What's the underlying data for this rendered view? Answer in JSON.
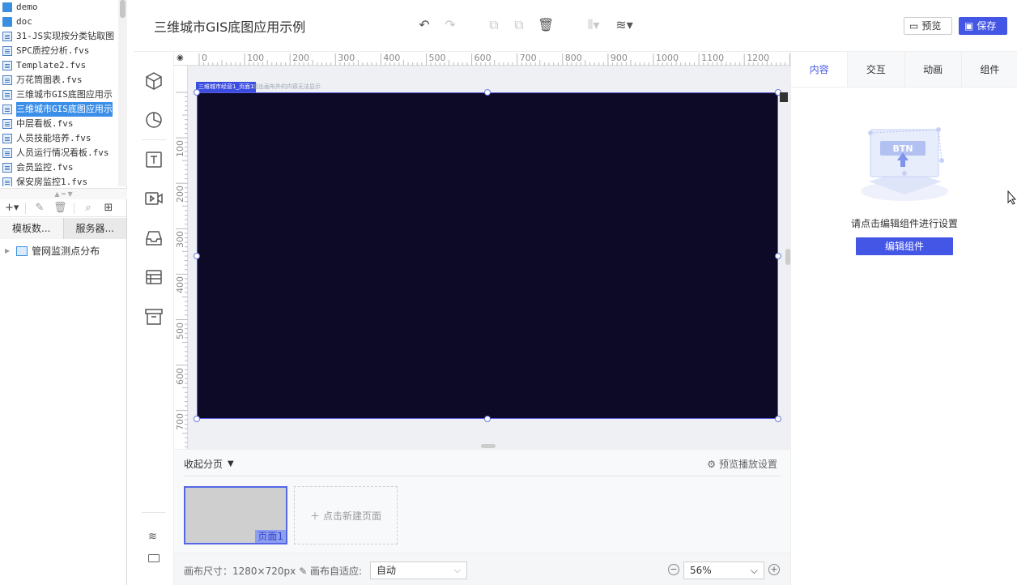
{
  "file_tree": {
    "items": [
      {
        "label": "demo",
        "type": "folder"
      },
      {
        "label": "doc",
        "type": "folder"
      },
      {
        "label": "31-JS实现按分类钻取图",
        "type": "file"
      },
      {
        "label": "SPC质控分析.fvs",
        "type": "file"
      },
      {
        "label": "Template2.fvs",
        "type": "file"
      },
      {
        "label": "万花筒图表.fvs",
        "type": "file"
      },
      {
        "label": "三维城市GIS底图应用示",
        "type": "file"
      },
      {
        "label": "三维城市GIS底图应用示",
        "type": "file",
        "selected": true
      },
      {
        "label": "中层看板.fvs",
        "type": "file"
      },
      {
        "label": "人员技能培养.fvs",
        "type": "file"
      },
      {
        "label": "人员运行情况看板.fvs",
        "type": "file"
      },
      {
        "label": "会员监控.fvs",
        "type": "file"
      },
      {
        "label": "保安房监控1.fvs",
        "type": "file"
      }
    ],
    "tabs": [
      {
        "label": "模板数..."
      },
      {
        "label": "服务器..."
      }
    ],
    "tree_node": "管网监测点分布"
  },
  "header": {
    "title": "三维城市GIS底图应用示例",
    "preview_label": "预览",
    "save_label": "保存"
  },
  "canvas": {
    "ruler_top": [
      "0",
      "100",
      "200",
      "300",
      "400",
      "500",
      "600",
      "700",
      "800",
      "900",
      "1000",
      "1100",
      "1200"
    ],
    "ruler_left": [
      "100",
      "200",
      "300",
      "400",
      "500",
      "600",
      "700"
    ],
    "screen_tag": "三维城市经营1_页面1",
    "screen_hint": "超出画布外的内容无法显示",
    "screen_color": "#0c0a26"
  },
  "pages": {
    "collapse_label": "收起分页",
    "preview_settings_label": "预览播放设置",
    "page_label": "页面1",
    "new_page_label": "点击新建页面"
  },
  "status": {
    "canvas_size": "画布尺寸：1280×720px",
    "fit_label": "画布自适应:",
    "fit_value": "自动",
    "zoom_value": "56%"
  },
  "right_panel": {
    "tabs": [
      {
        "label": "内容",
        "active": true
      },
      {
        "label": "交互"
      },
      {
        "label": "动画"
      },
      {
        "label": "组件"
      }
    ],
    "illustration_text": "BTN",
    "empty_text": "请点击编辑组件进行设置",
    "edit_button_label": "编辑组件"
  },
  "colors": {
    "accent": "#4456e6",
    "selected_file": "#3c8fe8"
  }
}
